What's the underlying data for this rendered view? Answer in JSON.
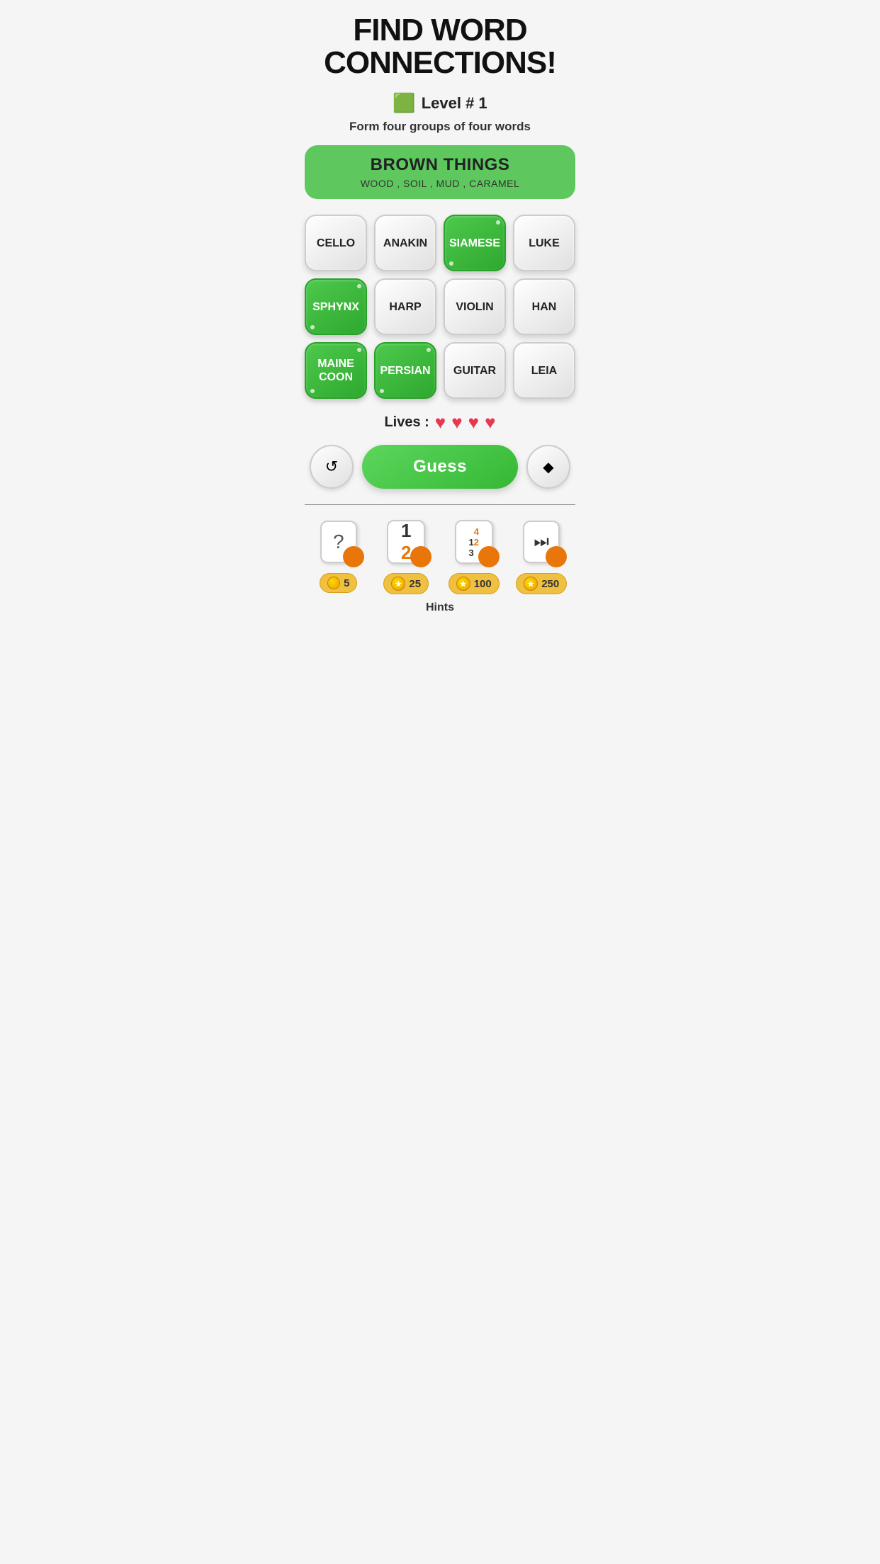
{
  "header": {
    "title": "FIND WORD\nCONNECTIONS!"
  },
  "level": {
    "icon": "🟦",
    "label": "Level # 1"
  },
  "subtitle": "Form four groups of four words",
  "category": {
    "name": "BROWN THINGS",
    "words": "WOOD , SOIL , MUD , CARAMEL"
  },
  "grid": [
    {
      "word": "CELLO",
      "selected": false
    },
    {
      "word": "ANAKIN",
      "selected": false
    },
    {
      "word": "SIAMESE",
      "selected": true
    },
    {
      "word": "LUKE",
      "selected": false
    },
    {
      "word": "SPHYNX",
      "selected": true
    },
    {
      "word": "HARP",
      "selected": false
    },
    {
      "word": "VIOLIN",
      "selected": false
    },
    {
      "word": "HAN",
      "selected": false
    },
    {
      "word": "MAINE\nCOON",
      "selected": true
    },
    {
      "word": "PERSIAN",
      "selected": true
    },
    {
      "word": "GUITAR",
      "selected": false
    },
    {
      "word": "LEIA",
      "selected": false
    }
  ],
  "lives": {
    "label": "Lives :",
    "count": 4
  },
  "buttons": {
    "shuffle": "↺",
    "guess": "Guess",
    "erase": "◆"
  },
  "hints": [
    {
      "type": "question",
      "cost": "5"
    },
    {
      "type": "numbers-12",
      "cost": "25"
    },
    {
      "type": "numbers-1234",
      "cost": "100"
    },
    {
      "type": "skip",
      "cost": "250"
    }
  ],
  "hints_label": "Hints"
}
